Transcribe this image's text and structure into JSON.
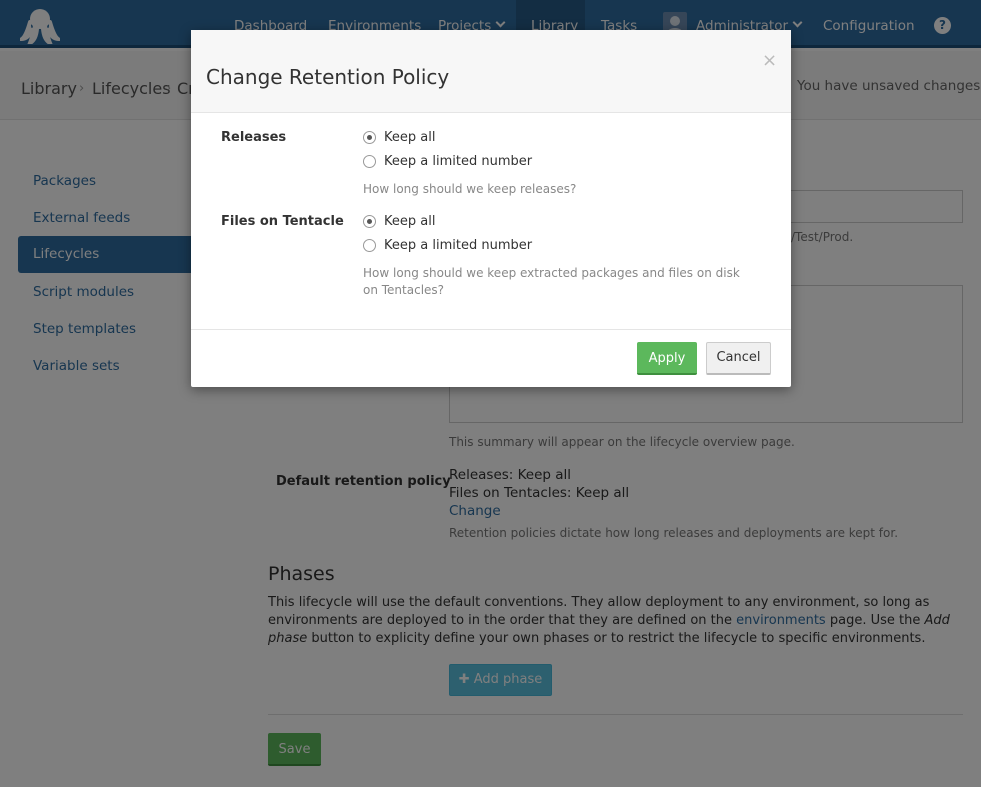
{
  "nav": {
    "items": [
      "Dashboard",
      "Environments",
      "Projects",
      "Library",
      "Tasks",
      "Administrator",
      "Configuration"
    ],
    "help": "?"
  },
  "breadcrumb": {
    "items": [
      "Library",
      "Lifecycles",
      "Cr"
    ],
    "separator": "›",
    "status": "You have unsaved changes"
  },
  "sidebar": {
    "items": [
      "Packages",
      "External feeds",
      "Lifecycles",
      "Script modules",
      "Step templates",
      "Variable sets"
    ],
    "active": "Lifecycles"
  },
  "form": {
    "environments_hint_partial": "/Test/Prod.",
    "summary_help": "This summary will appear on the lifecycle overview page.",
    "retention_label": "Default retention policy",
    "retention_releases": "Releases: Keep all",
    "retention_files": "Files on Tentacles: Keep all",
    "retention_change": "Change",
    "retention_help": "Retention policies dictate how long releases and deployments are kept for."
  },
  "phases": {
    "title": "Phases",
    "text_1": "This lifecycle will use the default conventions. They allow deployment to any environment, so long as environments are deployed to in the order that they are defined on the ",
    "text_link": "environments",
    "text_2": " page. Use the ",
    "text_em": "Add phase",
    "text_3": " button to explicity define your own phases or to restrict the lifecycle to specific environments.",
    "add_button": "Add phase",
    "add_icon": "✚"
  },
  "save_button": "Save",
  "modal": {
    "title": "Change Retention Policy",
    "close": "×",
    "releases_label": "Releases",
    "releases_option_1": "Keep all",
    "releases_option_2": "Keep a limited number",
    "releases_help": "How long should we keep releases?",
    "files_label": "Files on Tentacle",
    "files_option_1": "Keep all",
    "files_option_2": "Keep a limited number",
    "files_help": "How long should we keep extracted packages and files on disk on Tentacles?",
    "apply": "Apply",
    "cancel": "Cancel"
  },
  "colors": {
    "brand": "#2f6da1",
    "success": "#5cb85c",
    "info": "#5bc0de"
  }
}
